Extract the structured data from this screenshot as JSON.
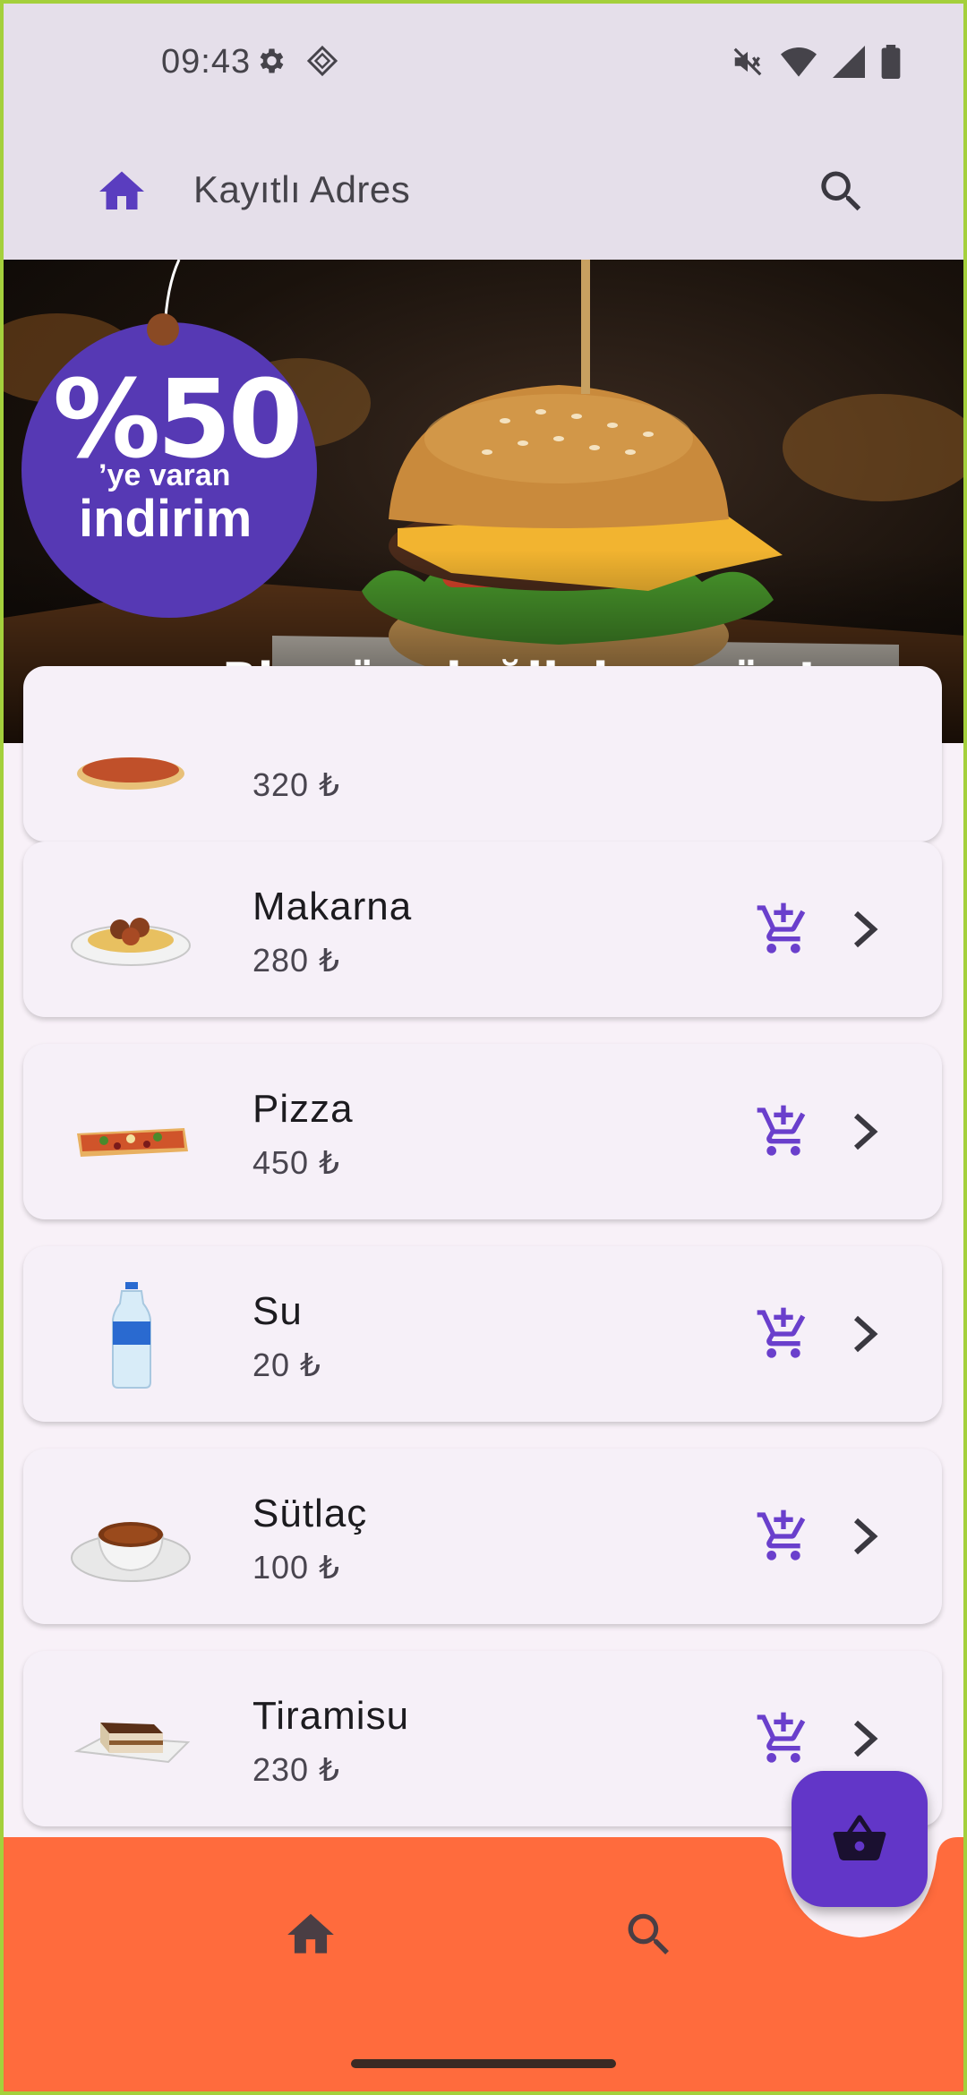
{
  "status_bar": {
    "time": "09:43",
    "left_icons": [
      "settings-icon",
      "app-icon"
    ],
    "right_icons": [
      "mute-icon",
      "wifi-icon",
      "signal-icon",
      "battery-icon"
    ]
  },
  "app_bar": {
    "title": "Kayıtlı Adres",
    "leading_icon": "home-icon",
    "trailing_icon": "search-icon",
    "accent_color": "#5a3dbf"
  },
  "banner": {
    "percent": "%50",
    "ye_varan": "’ye varan",
    "indirim": "indirim",
    "slogan": "Bir gün değil, her gün!"
  },
  "products": [
    {
      "name": "",
      "price": "320 ₺",
      "icon": "pizza"
    },
    {
      "name": "Makarna",
      "price": "280 ₺",
      "icon": "pasta"
    },
    {
      "name": "Pizza",
      "price": "450 ₺",
      "icon": "pizza"
    },
    {
      "name": "Su",
      "price": "20 ₺",
      "icon": "water-bottle"
    },
    {
      "name": "Sütlaç",
      "price": "100 ₺",
      "icon": "pudding"
    },
    {
      "name": "Tiramisu",
      "price": "230 ₺",
      "icon": "tiramisu"
    }
  ],
  "fab": {
    "icon": "basket-icon",
    "color": "#6236c8"
  },
  "bottom_nav": {
    "items": [
      {
        "icon": "home-icon"
      },
      {
        "icon": "search-icon"
      }
    ],
    "color": "#ff6b3d"
  }
}
